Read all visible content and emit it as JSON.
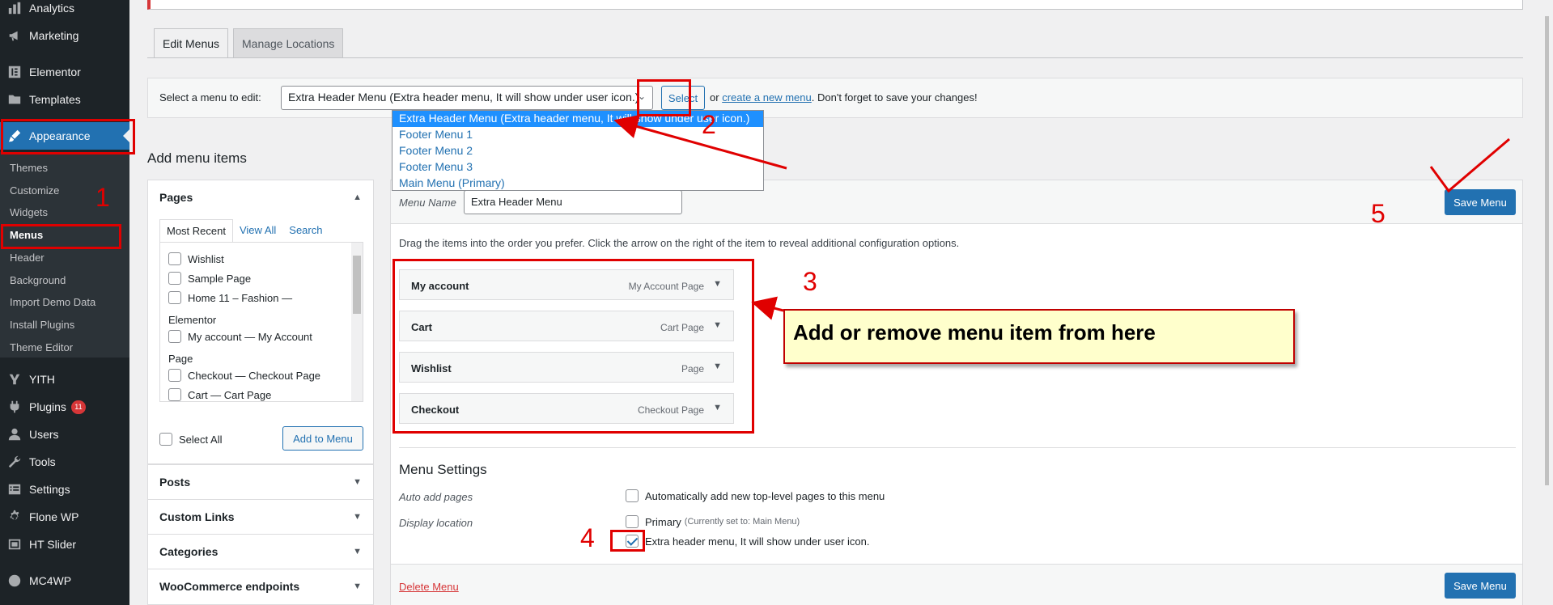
{
  "sidebar": {
    "items": [
      {
        "label": "Analytics",
        "icon": "bar-chart-icon"
      },
      {
        "label": "Marketing",
        "icon": "megaphone-icon"
      },
      {
        "label": "Elementor",
        "icon": "elementor-icon"
      },
      {
        "label": "Templates",
        "icon": "folder-icon"
      },
      {
        "label": "Appearance",
        "icon": "paintbrush-icon"
      },
      {
        "label": "YITH",
        "icon": "yith-icon"
      },
      {
        "label": "Plugins",
        "icon": "plugin-icon",
        "badge": "11"
      },
      {
        "label": "Users",
        "icon": "user-icon"
      },
      {
        "label": "Tools",
        "icon": "wrench-icon"
      },
      {
        "label": "Settings",
        "icon": "settings-icon"
      },
      {
        "label": "Flone WP",
        "icon": "gear-icon"
      },
      {
        "label": "HT Slider",
        "icon": "slider-icon"
      },
      {
        "label": "MC4WP",
        "icon": "mail-icon"
      }
    ],
    "submenu": [
      "Themes",
      "Customize",
      "Widgets",
      "Menus",
      "Header",
      "Background",
      "Import Demo Data",
      "Install Plugins",
      "Theme Editor"
    ]
  },
  "tabs": {
    "edit": "Edit Menus",
    "locations": "Manage Locations"
  },
  "select_bar": {
    "label": "Select a menu to edit:",
    "selected": "Extra Header Menu (Extra header menu, It will show under user icon.)",
    "button": "Select",
    "or_text": "or",
    "create_link": "create a new menu",
    "tail": ". Don't forget to save your changes!"
  },
  "dropdown": [
    "Extra Header Menu (Extra header menu, It will show under user icon.)",
    "Footer Menu 1",
    "Footer Menu 2",
    "Footer Menu 3",
    "Main Menu (Primary)"
  ],
  "add_items": {
    "title": "Add menu items",
    "pages": {
      "heading": "Pages",
      "subtabs": [
        "Most Recent",
        "View All",
        "Search"
      ],
      "items": [
        "Wishlist",
        "Sample Page",
        "Home 11 – Fashion —",
        "Elementor",
        "My account — My Account",
        "Page",
        "Checkout — Checkout Page",
        "Cart — Cart Page"
      ],
      "select_all": "Select All",
      "add_button": "Add to Menu"
    },
    "sections": [
      "Posts",
      "Custom Links",
      "Categories",
      "WooCommerce endpoints"
    ]
  },
  "structure": {
    "menu_name_label": "Menu Name",
    "menu_name_value": "Extra Header Menu",
    "save_button": "Save Menu",
    "drag_help": "Drag the items into the order you prefer. Click the arrow on the right of the item to reveal additional configuration options.",
    "items": [
      {
        "title": "My account",
        "type": "My Account Page"
      },
      {
        "title": "Cart",
        "type": "Cart Page"
      },
      {
        "title": "Wishlist",
        "type": "Page"
      },
      {
        "title": "Checkout",
        "type": "Checkout Page"
      }
    ],
    "settings": {
      "title": "Menu Settings",
      "auto_add_label": "Auto add pages",
      "auto_add_option": "Automatically add new top-level pages to this menu",
      "display_label": "Display location",
      "primary": "Primary",
      "primary_note": "(Currently set to: Main Menu)",
      "extra": "Extra header menu, It will show under user icon."
    },
    "delete_link": "Delete Menu"
  },
  "annotations": {
    "n1": "1",
    "n2": "2",
    "n3": "3",
    "n4": "4",
    "n5": "5",
    "callout": "Add or remove menu item from here",
    "color": "#e00000"
  }
}
